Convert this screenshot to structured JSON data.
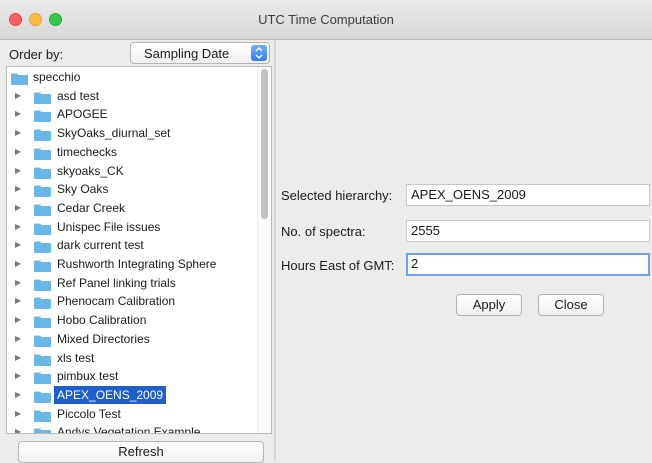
{
  "window": {
    "title": "UTC Time Computation"
  },
  "order_by": {
    "label": "Order by:",
    "selected": "Sampling Date"
  },
  "tree": {
    "root": "specchio",
    "items": [
      "asd test",
      "APOGEE",
      "SkyOaks_diurnal_set",
      "timechecks",
      "skyoaks_CK",
      "Sky Oaks",
      "Cedar Creek",
      "Unispec File issues",
      "dark current test",
      "Rushworth Integrating Sphere",
      "Ref Panel linking trials",
      "Phenocam Calibration",
      "Hobo Calibration",
      "Mixed Directories",
      "xls test",
      "pimbux test",
      "APEX_OENS_2009",
      "Piccolo Test",
      "Andys Vegetation Example"
    ],
    "selected_index": 16
  },
  "refresh_label": "Refresh",
  "form": {
    "hierarchy_label": "Selected hierarchy:",
    "hierarchy_value": "APEX_OENS_2009",
    "spectra_label": "No. of spectra:",
    "spectra_value": "2555",
    "hours_label": "Hours East of GMT:",
    "hours_value": "2"
  },
  "buttons": {
    "apply": "Apply",
    "close": "Close"
  },
  "colors": {
    "folder": "#6ab7e6",
    "selection": "#1f5fcc",
    "focus_ring": "#6ca2ea"
  }
}
